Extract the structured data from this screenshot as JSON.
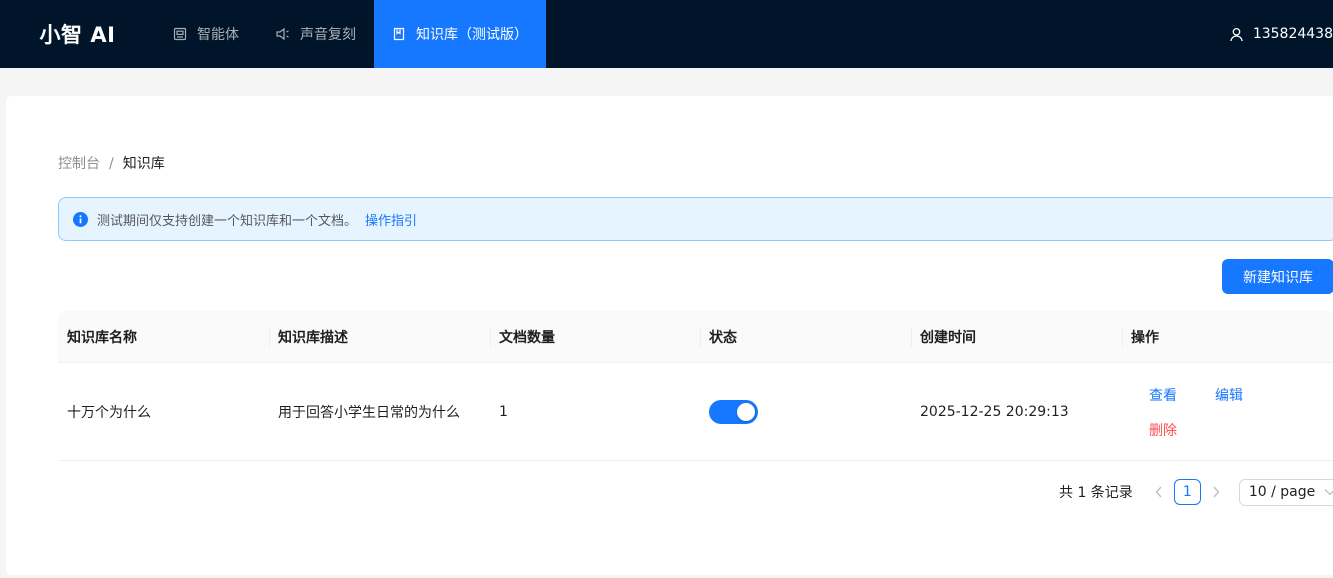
{
  "header": {
    "brand": "小智 AI",
    "nav": [
      {
        "label": "智能体",
        "icon": "robot-icon"
      },
      {
        "label": "声音复刻",
        "icon": "sound-icon"
      },
      {
        "label": "知识库（测试版）",
        "icon": "book-icon",
        "active": true
      }
    ],
    "user": "135824438"
  },
  "breadcrumb": {
    "root": "控制台",
    "separator": "/",
    "current": "知识库"
  },
  "alert": {
    "text": "测试期间仅支持创建一个知识库和一个文档。",
    "link": "操作指引"
  },
  "toolbar": {
    "create_label": "新建知识库"
  },
  "table": {
    "columns": [
      "知识库名称",
      "知识库描述",
      "文档数量",
      "状态",
      "创建时间",
      "操作"
    ],
    "rows": [
      {
        "name": "十万个为什么",
        "description": "用于回答小学生日常的为什么",
        "doc_count": "1",
        "enabled": true,
        "created": "2025-12-25 20:29:13",
        "actions": {
          "view": "查看",
          "edit": "编辑",
          "delete": "删除"
        }
      }
    ]
  },
  "pagination": {
    "total_text": "共 1 条记录",
    "current_page": "1",
    "page_size": "10 / page"
  },
  "colors": {
    "header_bg": "#001529",
    "primary": "#1677ff",
    "danger": "#ff4d4f"
  }
}
